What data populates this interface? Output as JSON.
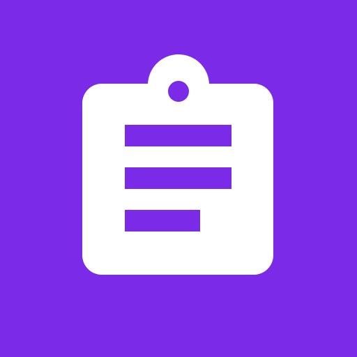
{
  "icon": {
    "name": "clipboard-icon",
    "background_color": "#7b2ae8",
    "foreground_color": "#ffffff",
    "text_lines": 3
  }
}
